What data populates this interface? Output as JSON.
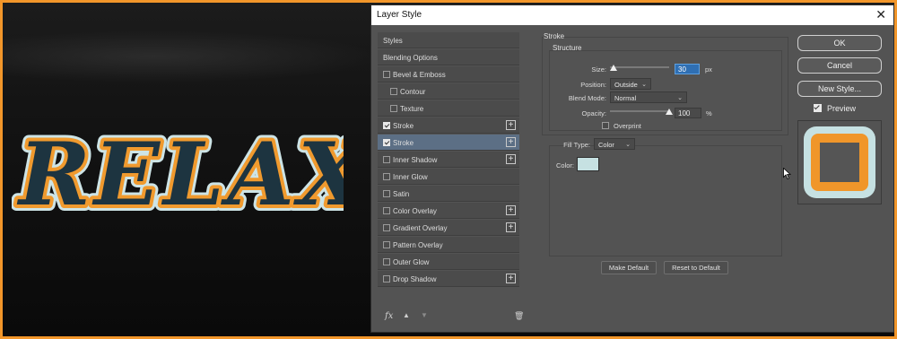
{
  "canvas": {
    "artwork_text": "RELAX",
    "colors": {
      "fill": "#1d3440",
      "inner_stroke": "#f09a2e",
      "outer_stroke": "#cde4e6"
    }
  },
  "dialog": {
    "title": "Layer Style",
    "close_glyph": "✕"
  },
  "styles_list": [
    {
      "label": "Styles",
      "type": "header"
    },
    {
      "label": "Blending Options",
      "type": "header"
    },
    {
      "label": "Bevel & Emboss",
      "checked": false,
      "plus": false,
      "indent": 0
    },
    {
      "label": "Contour",
      "checked": false,
      "plus": false,
      "indent": 1
    },
    {
      "label": "Texture",
      "checked": false,
      "plus": false,
      "indent": 1
    },
    {
      "label": "Stroke",
      "checked": true,
      "plus": true,
      "indent": 0
    },
    {
      "label": "Stroke",
      "checked": true,
      "plus": true,
      "indent": 0,
      "selected": true
    },
    {
      "label": "Inner Shadow",
      "checked": false,
      "plus": true,
      "indent": 0
    },
    {
      "label": "Inner Glow",
      "checked": false,
      "plus": false,
      "indent": 0
    },
    {
      "label": "Satin",
      "checked": false,
      "plus": false,
      "indent": 0
    },
    {
      "label": "Color Overlay",
      "checked": false,
      "plus": true,
      "indent": 0
    },
    {
      "label": "Gradient Overlay",
      "checked": false,
      "plus": true,
      "indent": 0
    },
    {
      "label": "Pattern Overlay",
      "checked": false,
      "plus": false,
      "indent": 0
    },
    {
      "label": "Outer Glow",
      "checked": false,
      "plus": false,
      "indent": 0
    },
    {
      "label": "Drop Shadow",
      "checked": false,
      "plus": true,
      "indent": 0
    }
  ],
  "list_bottom": {
    "fx": "fx",
    "up": "▲",
    "down": "▼",
    "trash": "🗑"
  },
  "stroke_panel": {
    "section_title": "Stroke",
    "structure_title": "Structure",
    "size_label": "Size:",
    "size_value": "30",
    "size_unit": "px",
    "size_level": 0.06,
    "position_label": "Position:",
    "position_value": "Outside",
    "blend_mode_label": "Blend Mode:",
    "blend_mode_value": "Normal",
    "opacity_label": "Opacity:",
    "opacity_value": "100",
    "opacity_unit": "%",
    "opacity_level": 1.0,
    "overprint_label": "Overprint",
    "overprint_checked": false,
    "fill_type_label": "Fill Type:",
    "fill_type_value": "Color",
    "color_label": "Color:",
    "color_swatch": "#c6e1e2",
    "make_default": "Make Default",
    "reset_default": "Reset to Default"
  },
  "actions": {
    "ok": "OK",
    "cancel": "Cancel",
    "new_style": "New Style...",
    "preview_label": "Preview",
    "preview_checked": true
  },
  "preview_colors": {
    "outer": "#c6e1e2",
    "inner": "#f0962a",
    "core": "#555555"
  }
}
